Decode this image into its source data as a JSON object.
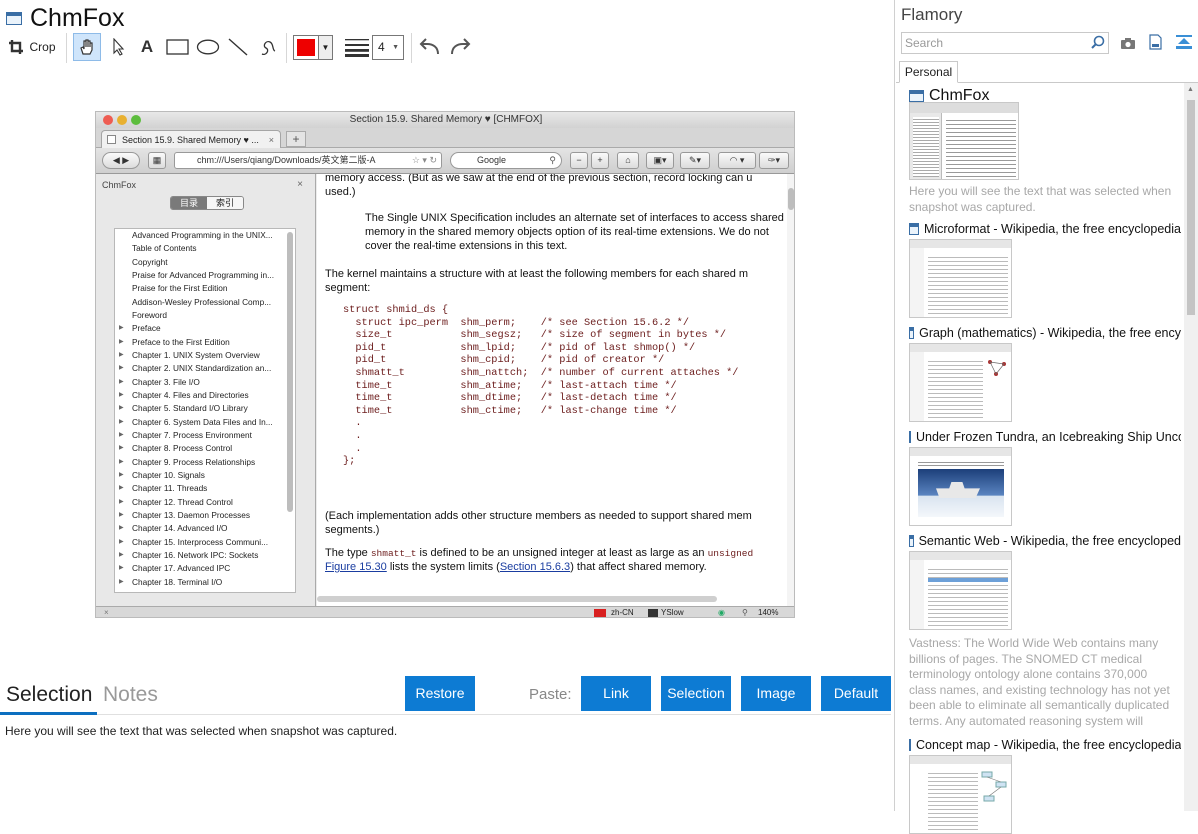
{
  "window": {
    "title": "ChmFox"
  },
  "toolbar": {
    "crop_label": "Crop",
    "line_width": "4",
    "color": "#ee0000"
  },
  "captured": {
    "title": "Section 15.9.  Shared Memory ♥ [CHMFOX]",
    "tab": "Section 15.9.  Shared Memory ♥ ...",
    "url": "chm:///Users/qiang/Downloads/英文第二版-A",
    "search": "Google",
    "sidebar_title": "ChmFox",
    "seg_toc": "目录",
    "seg_index": "索引",
    "toc": [
      {
        "label": "Advanced Programming in the UNIX...",
        "exp": false
      },
      {
        "label": "Table of Contents",
        "exp": false
      },
      {
        "label": "Copyright",
        "exp": false
      },
      {
        "label": "Praise for Advanced Programming in...",
        "exp": false
      },
      {
        "label": "Praise for the First Edition",
        "exp": false
      },
      {
        "label": "Addison-Wesley Professional Comp...",
        "exp": false
      },
      {
        "label": "Foreword",
        "exp": false
      },
      {
        "label": "Preface",
        "exp": true
      },
      {
        "label": "Preface to the First Edition",
        "exp": true
      },
      {
        "label": "Chapter 1.  UNIX System Overview",
        "exp": true
      },
      {
        "label": "Chapter 2.  UNIX Standardization an...",
        "exp": true
      },
      {
        "label": "Chapter 3.  File I/O",
        "exp": true
      },
      {
        "label": "Chapter 4.  Files and Directories",
        "exp": true
      },
      {
        "label": "Chapter 5.  Standard I/O Library",
        "exp": true
      },
      {
        "label": "Chapter 6.  System Data Files and In...",
        "exp": true
      },
      {
        "label": "Chapter 7.  Process Environment",
        "exp": true
      },
      {
        "label": "Chapter 8.  Process Control",
        "exp": true
      },
      {
        "label": "Chapter 9.  Process Relationships",
        "exp": true
      },
      {
        "label": "Chapter 10.  Signals",
        "exp": true
      },
      {
        "label": "Chapter 11.  Threads",
        "exp": true
      },
      {
        "label": "Chapter 12.  Thread Control",
        "exp": true
      },
      {
        "label": "Chapter 13.  Daemon Processes",
        "exp": true
      },
      {
        "label": "Chapter 14.  Advanced I/O",
        "exp": true
      },
      {
        "label": "Chapter 15.  Interprocess Communi...",
        "exp": true
      },
      {
        "label": "Chapter 16.  Network IPC: Sockets",
        "exp": true
      },
      {
        "label": "Chapter 17.  Advanced IPC",
        "exp": true
      },
      {
        "label": "Chapter 18.  Terminal I/O",
        "exp": true
      }
    ],
    "p0": "memory access. (But as we saw at the end of the previous section, record locking can u used.)",
    "p1": "The Single UNIX Specification includes an alternate set of interfaces to access shared memory in the shared memory objects option of its real-time extensions. We do not cover the real-time extensions in this text.",
    "p2": "The kernel maintains a structure with at least the following members for each shared m segment:",
    "code": "struct shmid_ds {\n  struct ipc_perm  shm_perm;    /* see Section 15.6.2 */\n  size_t           shm_segsz;   /* size of segment in bytes */\n  pid_t            shm_lpid;    /* pid of last shmop() */\n  pid_t            shm_cpid;    /* pid of creator */\n  shmatt_t         shm_nattch;  /* number of current attaches */\n  time_t           shm_atime;   /* last-attach time */\n  time_t           shm_dtime;   /* last-detach time */\n  time_t           shm_ctime;   /* last-change time */\n  .\n  .\n  .\n};",
    "p3": "(Each implementation adds other structure members as needed to support shared mem segments.)",
    "p4a": "The type ",
    "p4b": "shmatt_t",
    "p4c": " is defined to be an unsigned integer at least as large as an ",
    "p4d": "unsigned",
    "p5a": "Figure 15.30",
    "p5b": " lists the system limits (",
    "p5c": "Section 15.6.3",
    "p5d": ") that affect shared memory.",
    "status_lang": "zh-CN",
    "status_yslow": "YSlow",
    "status_zoom": "140%"
  },
  "lower": {
    "tab_selection": "Selection",
    "tab_notes": "Notes",
    "restore": "Restore",
    "paste_label": "Paste:",
    "link": "Link",
    "selection": "Selection",
    "image": "Image",
    "default": "Default",
    "text": "Here you will see the text that was selected when snapshot was captured."
  },
  "right": {
    "title": "Flamory",
    "search_placeholder": "Search",
    "tab": "Personal",
    "snapshots": [
      {
        "title": "ChmFox",
        "desc": "Here you will see the text that was selected when snapshot was captured."
      },
      {
        "title": "Microformat - Wikipedia, the free encyclopedia",
        "desc": ""
      },
      {
        "title": "Graph (mathematics) - Wikipedia, the free ency",
        "desc": ""
      },
      {
        "title": "Under Frozen Tundra, an Icebreaking Ship Unco",
        "desc": ""
      },
      {
        "title": "Semantic Web - Wikipedia, the free encycloped",
        "desc": "Vastness: The World Wide Web contains many billions of pages. The SNOMED CT medical terminology ontology alone contains 370,000 class names, and existing technology has not yet been able to eliminate all semantically duplicated terms. Any automated reasoning system will have to deal with truly huge inputs."
      },
      {
        "title": "Concept map - Wikipedia, the free encyclopedia",
        "desc": ""
      }
    ]
  }
}
